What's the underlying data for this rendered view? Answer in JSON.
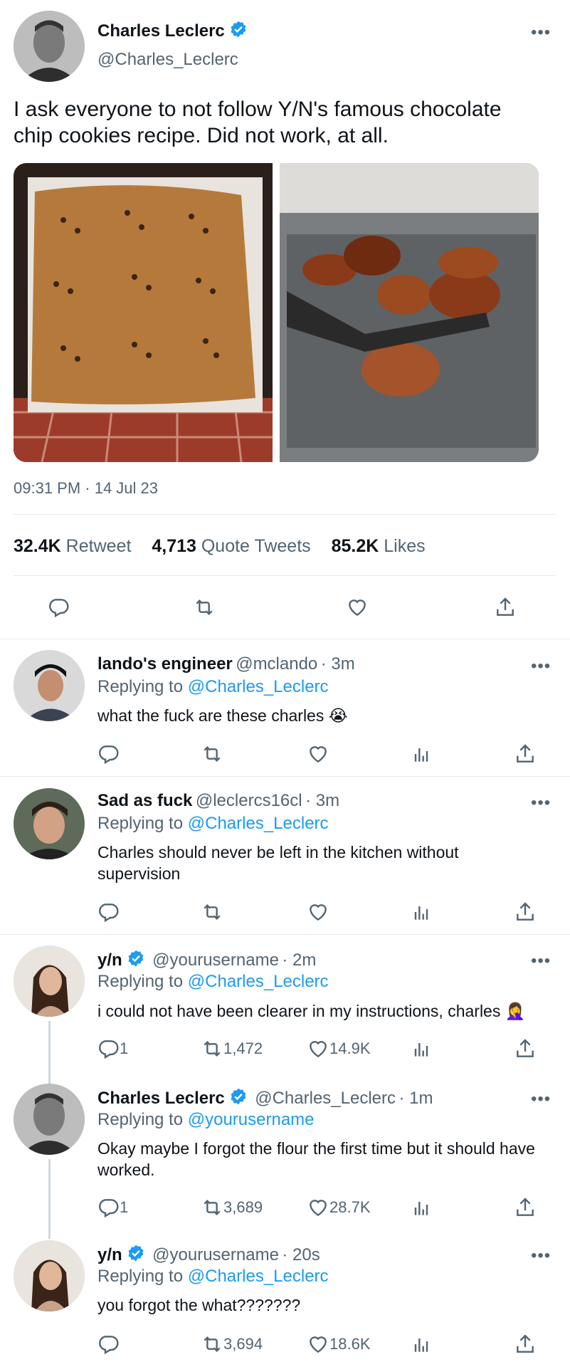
{
  "main_tweet": {
    "name": "Charles Leclerc",
    "handle": "@Charles_Leclerc",
    "text": "I ask everyone to not follow Y/N's famous chocolate chip cookies recipe. Did not work, at all.",
    "time": "09:31 PM · 14 Jul 23",
    "stats": {
      "retweets_count": "32.4K",
      "retweets_label": "Retweet",
      "quotes_count": "4,713",
      "quotes_label": "Quote Tweets",
      "likes_count": "85.2K",
      "likes_label": "Likes"
    }
  },
  "replies": [
    {
      "name": "lando's engineer",
      "handle": "@mclando",
      "time": "· 3m",
      "replying_label": "Replying to",
      "replying_to": "@Charles_Leclerc",
      "text": "what the fuck are these charles 😭",
      "reply_count": "",
      "retweet_count": "",
      "like_count": ""
    },
    {
      "name": "Sad as fuck",
      "handle": "@leclercs16cl",
      "time": "· 3m",
      "replying_label": "Replying to",
      "replying_to": "@Charles_Leclerc",
      "text": "Charles should never be left in the kitchen without supervision",
      "reply_count": "",
      "retweet_count": "",
      "like_count": ""
    },
    {
      "name": "y/n",
      "handle": "@yourusername",
      "time": "· 2m",
      "replying_label": "Replying to",
      "replying_to": "@Charles_Leclerc",
      "text": "i could not have been clearer in my instructions, charles 🤦‍♀️",
      "reply_count": "1",
      "retweet_count": "1,472",
      "like_count": "14.9K"
    },
    {
      "name": "Charles Leclerc",
      "handle": "@Charles_Leclerc",
      "time": "· 1m",
      "replying_label": "Replying to",
      "replying_to": "@yourusername",
      "text": "Okay maybe I forgot the flour the first time but it should have worked.",
      "reply_count": "1",
      "retweet_count": "3,689",
      "like_count": "28.7K"
    },
    {
      "name": "y/n",
      "handle": "@yourusername",
      "time": "· 20s",
      "replying_label": "Replying to",
      "replying_to": "@Charles_Leclerc",
      "text": "you forgot the what???????",
      "reply_count": "",
      "retweet_count": "3,694",
      "like_count": "18.6K"
    }
  ],
  "icons": {
    "more": "more-icon",
    "verified": "verified-badge-icon",
    "reply": "reply-icon",
    "retweet": "retweet-icon",
    "like": "heart-icon",
    "analytics": "analytics-icon",
    "share": "share-icon"
  },
  "colors": {
    "accent": "#1d9bf0",
    "secondary_text": "#536471",
    "text": "#0f1419"
  }
}
